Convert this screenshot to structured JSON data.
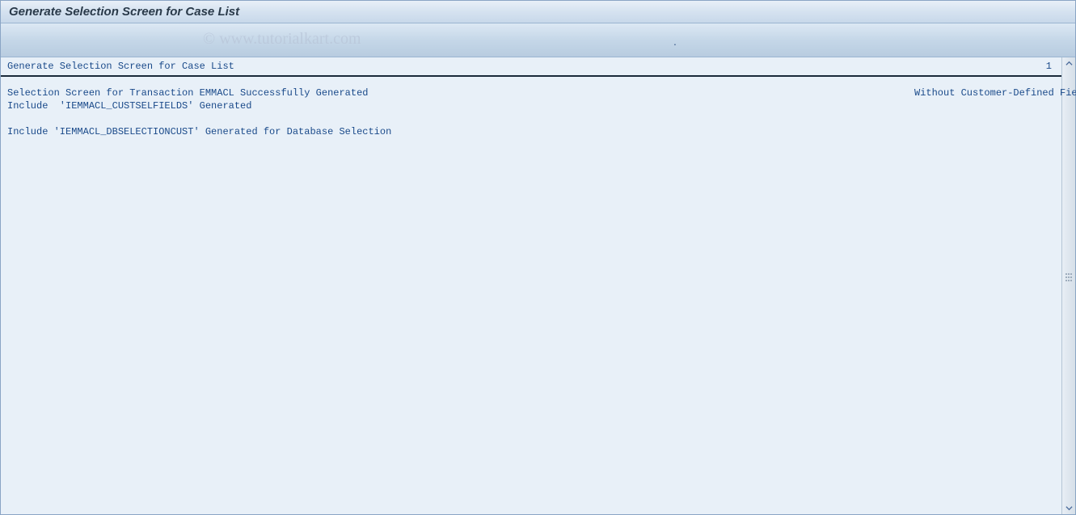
{
  "window": {
    "title": "Generate Selection Screen for Case List"
  },
  "watermark": "© www.tutorialkart.com",
  "toolbar_dot": ".",
  "report": {
    "header": {
      "title": "Generate Selection Screen for Case List",
      "page_number": "1"
    },
    "lines": [
      {
        "left": "Selection Screen for Transaction EMMACL Successfully Generated",
        "right": "Without Customer-Defined Fields"
      },
      {
        "left": "Include  'IEMMACL_CUSTSELFIELDS' Generated",
        "right": ""
      },
      {
        "left": "",
        "right": ""
      },
      {
        "left": "Include 'IEMMACL_DBSELECTIONCUST' Generated for Database Selection",
        "right": ""
      }
    ]
  }
}
